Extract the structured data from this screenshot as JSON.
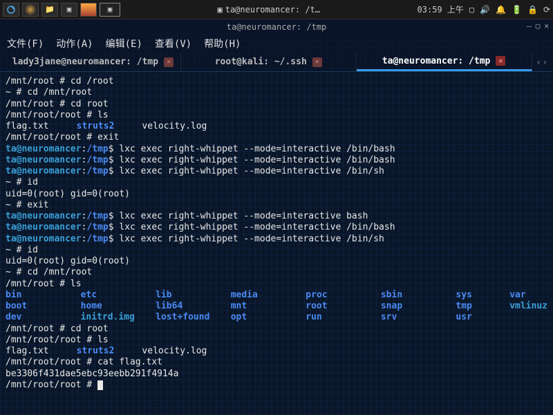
{
  "topbar": {
    "app_title": "ta@neuromancer: /t…",
    "clock": "03:59 上午",
    "icons": {
      "logo": "◉",
      "term": "▣"
    }
  },
  "window": {
    "title": "ta@neuromancer: /tmp"
  },
  "menubar": {
    "file": "文件(F)",
    "action": "动作(A)",
    "edit": "编辑(E)",
    "view": "查看(V)",
    "help": "帮助(H)"
  },
  "tabs": [
    {
      "label": "lady3jane@neuromancer: /tmp",
      "active": false
    },
    {
      "label": "root@kali: ~/.ssh",
      "active": false
    },
    {
      "label": "ta@neuromancer: /tmp",
      "active": true
    }
  ],
  "terminal": {
    "lines": [
      {
        "seg": [
          {
            "t": "/mnt/root # cd /root",
            "c": "c-white"
          }
        ]
      },
      {
        "seg": [
          {
            "t": "~ # cd /mnt/root",
            "c": "c-white"
          }
        ]
      },
      {
        "seg": [
          {
            "t": "/mnt/root # cd root",
            "c": "c-white"
          }
        ]
      },
      {
        "seg": [
          {
            "t": "/mnt/root/root # ls",
            "c": "c-white"
          }
        ]
      },
      {
        "ls": [
          {
            "t": "flag.txt",
            "c": "c-white"
          },
          {
            "t": "struts2",
            "c": "c-blue"
          },
          {
            "t": "velocity.log",
            "c": "c-white"
          }
        ]
      },
      {
        "seg": [
          {
            "t": "/mnt/root/root # exit",
            "c": "c-white"
          }
        ]
      },
      {
        "seg": [
          {
            "t": "ta@neuromancer",
            "c": "c-cyan"
          },
          {
            "t": ":",
            "c": "c-white"
          },
          {
            "t": "/tmp",
            "c": "c-blue"
          },
          {
            "t": "$ lxc exec right-whippet --mode=interactive /bin/bash",
            "c": "c-white"
          }
        ]
      },
      {
        "seg": [
          {
            "t": "ta@neuromancer",
            "c": "c-cyan"
          },
          {
            "t": ":",
            "c": "c-white"
          },
          {
            "t": "/tmp",
            "c": "c-blue"
          },
          {
            "t": "$ lxc exec right-whippet --mode=interactive /bin/bash",
            "c": "c-white"
          }
        ]
      },
      {
        "seg": [
          {
            "t": "ta@neuromancer",
            "c": "c-cyan"
          },
          {
            "t": ":",
            "c": "c-white"
          },
          {
            "t": "/tmp",
            "c": "c-blue"
          },
          {
            "t": "$ lxc exec right-whippet --mode=interactive /bin/sh",
            "c": "c-white"
          }
        ]
      },
      {
        "seg": [
          {
            "t": "~ # id",
            "c": "c-white"
          }
        ]
      },
      {
        "seg": [
          {
            "t": "uid=0(root) gid=0(root)",
            "c": "c-white"
          }
        ]
      },
      {
        "seg": [
          {
            "t": "~ # exit",
            "c": "c-white"
          }
        ]
      },
      {
        "seg": [
          {
            "t": "ta@neuromancer",
            "c": "c-cyan"
          },
          {
            "t": ":",
            "c": "c-white"
          },
          {
            "t": "/tmp",
            "c": "c-blue"
          },
          {
            "t": "$ lxc exec right-whippet --mode=interactive bash",
            "c": "c-white"
          }
        ]
      },
      {
        "seg": [
          {
            "t": "ta@neuromancer",
            "c": "c-cyan"
          },
          {
            "t": ":",
            "c": "c-white"
          },
          {
            "t": "/tmp",
            "c": "c-blue"
          },
          {
            "t": "$ lxc exec right-whippet --mode=interactive /bin/bash",
            "c": "c-white"
          }
        ]
      },
      {
        "seg": [
          {
            "t": "ta@neuromancer",
            "c": "c-cyan"
          },
          {
            "t": ":",
            "c": "c-white"
          },
          {
            "t": "/tmp",
            "c": "c-blue"
          },
          {
            "t": "$ lxc exec right-whippet --mode=interactive /bin/sh",
            "c": "c-white"
          }
        ]
      },
      {
        "seg": [
          {
            "t": "~ # id",
            "c": "c-white"
          }
        ]
      },
      {
        "seg": [
          {
            "t": "uid=0(root) gid=0(root)",
            "c": "c-white"
          }
        ]
      },
      {
        "seg": [
          {
            "t": "~ # cd /mnt/root",
            "c": "c-white"
          }
        ]
      },
      {
        "seg": [
          {
            "t": "/mnt/root # ls",
            "c": "c-white"
          }
        ]
      }
    ],
    "dir_listing": [
      {
        "t": "bin",
        "c": ""
      },
      {
        "t": "etc",
        "c": ""
      },
      {
        "t": "lib",
        "c": ""
      },
      {
        "t": "media",
        "c": ""
      },
      {
        "t": "proc",
        "c": ""
      },
      {
        "t": "sbin",
        "c": ""
      },
      {
        "t": "sys",
        "c": ""
      },
      {
        "t": "boot",
        "c": ""
      },
      {
        "t": "home",
        "c": ""
      },
      {
        "t": "lib64",
        "c": ""
      },
      {
        "t": "mnt",
        "c": ""
      },
      {
        "t": "root",
        "c": ""
      },
      {
        "t": "snap",
        "c": ""
      },
      {
        "t": "tmp",
        "c": ""
      },
      {
        "t": "dev",
        "c": ""
      },
      {
        "t": "initrd.img",
        "c": "lt"
      },
      {
        "t": "lost+found",
        "c": ""
      },
      {
        "t": "opt",
        "c": ""
      },
      {
        "t": "run",
        "c": ""
      },
      {
        "t": "srv",
        "c": ""
      },
      {
        "t": "usr",
        "c": ""
      }
    ],
    "dir_extra": [
      {
        "t": "var",
        "c": ""
      },
      {
        "t": "vmlinuz",
        "c": "lt"
      }
    ],
    "after_lines": [
      {
        "seg": [
          {
            "t": "/mnt/root # cd root",
            "c": "c-white"
          }
        ]
      },
      {
        "seg": [
          {
            "t": "/mnt/root/root # ls",
            "c": "c-white"
          }
        ]
      },
      {
        "ls": [
          {
            "t": "flag.txt",
            "c": "c-white"
          },
          {
            "t": "struts2",
            "c": "c-blue"
          },
          {
            "t": "velocity.log",
            "c": "c-white"
          }
        ]
      },
      {
        "seg": [
          {
            "t": "/mnt/root/root # cat flag.txt",
            "c": "c-white"
          }
        ]
      },
      {
        "seg": [
          {
            "t": "be3306f431dae5ebc93eebb291f4914a",
            "c": "c-white"
          }
        ]
      },
      {
        "seg": [
          {
            "t": "/mnt/root/root # ",
            "c": "c-white"
          }
        ],
        "cursor": true
      }
    ]
  }
}
